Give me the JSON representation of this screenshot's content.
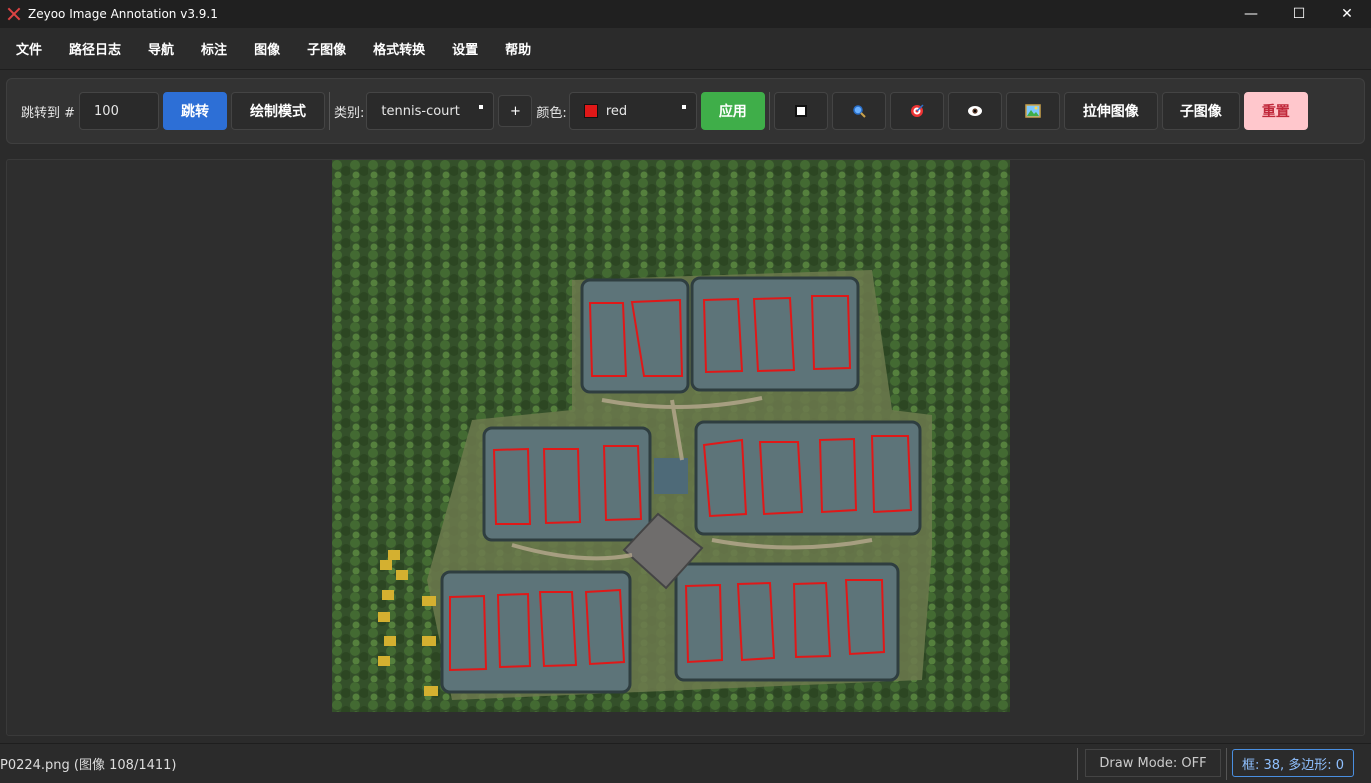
{
  "window": {
    "title": "Zeyoo Image Annotation v3.9.1",
    "min": "—",
    "max": "☐",
    "close": "✕"
  },
  "menu": [
    "文件",
    "路径日志",
    "导航",
    "标注",
    "图像",
    "子图像",
    "格式转换",
    "设置",
    "帮助"
  ],
  "toolbar": {
    "jump_label": "跳转到 #",
    "jump_value": "100",
    "jump_button": "跳转",
    "draw_mode_button": "绘制模式",
    "category_label": "类别:",
    "category_value": "tennis-court",
    "add_button": "+",
    "color_label": "颜色:",
    "color_value": "red",
    "apply_button": "应用",
    "icons": [
      "square-icon",
      "magnifier-icon",
      "target-icon",
      "eye-icon",
      "picture-icon"
    ],
    "stretch_button": "拉伸图像",
    "subimage_button": "子图像",
    "reset_button": "重置"
  },
  "colors": {
    "accent_blue": "#2d6fd6",
    "apply_green": "#3fae49",
    "reset_pink": "#ffc7cc",
    "annotation_red": "#e01818"
  },
  "status": {
    "file": "P0224.png (图像 108/1411)",
    "draw_mode": "Draw Mode: OFF",
    "counts": "框: 38, 多边形: 0"
  }
}
